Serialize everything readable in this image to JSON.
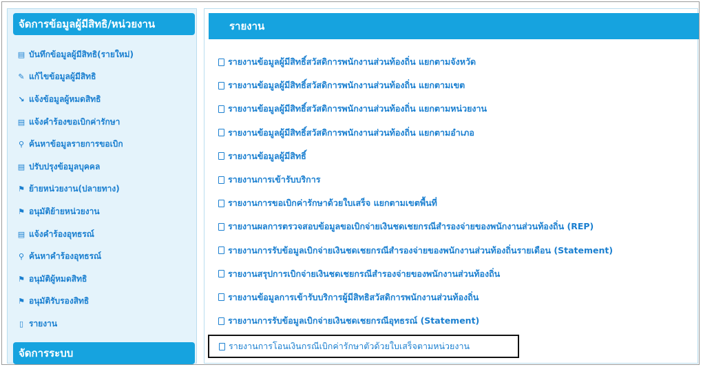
{
  "sidebar": {
    "header": "จัดการข้อมูลผู้มีสิทธิ/หน่วยงาน",
    "items": [
      {
        "icon": "save-icon",
        "glyph": "▤",
        "label": "บันทึกข้อมูลผู้มีสิทธิ(รายใหม่)"
      },
      {
        "icon": "wrench-icon",
        "glyph": "✎",
        "label": "แก้ไขข้อมูลผู้มีสิทธิ"
      },
      {
        "icon": "chart-icon",
        "glyph": "↘",
        "label": "แจ้งข้อมูลผู้หมดสิทธิ"
      },
      {
        "icon": "save-icon",
        "glyph": "▤",
        "label": "แจ้งคำร้องขอเบิกค่ารักษา"
      },
      {
        "icon": "search-icon",
        "glyph": "⚲",
        "label": "ค้นหาข้อมูลรายการขอเบิก"
      },
      {
        "icon": "save-icon",
        "glyph": "▤",
        "label": "ปรับปรุงข้อมูลบุคคล"
      },
      {
        "icon": "flag-icon",
        "glyph": "⚑",
        "label": "ย้ายหน่วยงาน(ปลายทาง)"
      },
      {
        "icon": "flag-icon",
        "glyph": "⚑",
        "label": "อนุมัติย้ายหน่วยงาน"
      },
      {
        "icon": "save-icon",
        "glyph": "▤",
        "label": "แจ้งคำร้องอุทธรณ์"
      },
      {
        "icon": "search-icon",
        "glyph": "⚲",
        "label": "ค้นหาคำร้องอุทธรณ์"
      },
      {
        "icon": "flag-icon",
        "glyph": "⚑",
        "label": "อนุมัติผู้หมดสิทธิ"
      },
      {
        "icon": "flag-icon",
        "glyph": "⚑",
        "label": "อนุมัติรับรองสิทธิ"
      },
      {
        "icon": "document-icon",
        "glyph": "▯",
        "label": "รายงาน"
      }
    ],
    "footer_header": "จัดการระบบ"
  },
  "main": {
    "header": "รายงาน",
    "items": [
      "รายงานข้อมูลผู้มีสิทธิ์สวัสดิการพนักงานส่วนท้องถิ่น แยกตามจังหวัด",
      "รายงานข้อมูลผู้มีสิทธิ์สวัสดิการพนักงานส่วนท้องถิ่น แยกตามเขต",
      "รายงานข้อมูลผู้มีสิทธิ์สวัสดิการพนักงานส่วนท้องถิ่น แยกตามหน่วยงาน",
      "รายงานข้อมูลผู้มีสิทธิ์สวัสดิการพนักงานส่วนท้องถิ่น แยกตามอำเภอ",
      "รายงานข้อมูลผู้มีสิทธิ์",
      "รายงานการเข้ารับบริการ",
      "รายงานการขอเบิกค่ารักษาด้วยใบเสร็จ แยกตามเขตพื้นที่",
      "รายงานผลการตรวจสอบข้อมูลขอเบิกจ่ายเงินชดเชยกรณีสำรองจ่ายของพนักงานส่วนท้องถิ่น (REP)",
      "รายงานการรับข้อมูลเบิกจ่ายเงินชดเชยกรณีสำรองจ่ายของพนักงานส่วนท้องถิ่นรายเดือน (Statement)",
      "รายงานสรุปการเบิกจ่ายเงินชดเชยกรณีสำรองจ่ายของพนักงานส่วนท้องถิ่น",
      "รายงานข้อมูลการเข้ารับบริการผู้มีสิทธิสวัสดิการพนักงานส่วนท้องถิ่น",
      "รายงานการรับข้อมูลเบิกจ่ายเงินชดเชยกรณีอุทธรณ์ (Statement)"
    ],
    "highlighted_item": "รายงานการโอนเงินกรณีเบิกค่ารักษาตัวด้วยใบเสร็จตามหน่วยงาน"
  }
}
